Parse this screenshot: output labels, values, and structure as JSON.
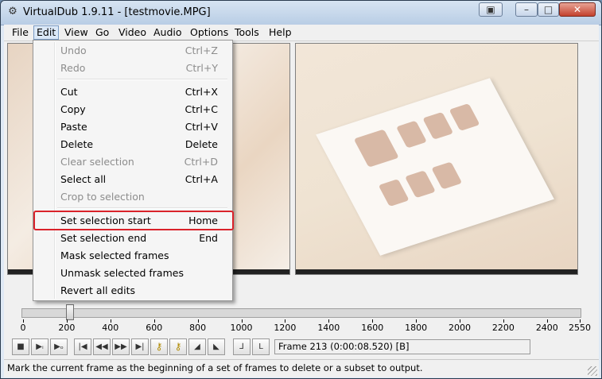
{
  "window": {
    "title": "VirtualDub 1.9.11 - [testmovie.MPG]"
  },
  "title_buttons": {
    "restore": "▣",
    "minimize": "–",
    "maximize": "□",
    "close": "✕"
  },
  "menubar": [
    "File",
    "Edit",
    "View",
    "Go",
    "Video",
    "Audio",
    "Options",
    "Tools",
    "Help"
  ],
  "edit_menu": [
    {
      "label": "Undo",
      "shortcut": "Ctrl+Z",
      "disabled": true
    },
    {
      "label": "Redo",
      "shortcut": "Ctrl+Y",
      "disabled": true
    },
    {
      "label": "Cut",
      "shortcut": "Ctrl+X",
      "disabled": false
    },
    {
      "label": "Copy",
      "shortcut": "Ctrl+C",
      "disabled": false
    },
    {
      "label": "Paste",
      "shortcut": "Ctrl+V",
      "disabled": false
    },
    {
      "label": "Delete",
      "shortcut": "Delete",
      "disabled": false
    },
    {
      "label": "Clear selection",
      "shortcut": "Ctrl+D",
      "disabled": true
    },
    {
      "label": "Select all",
      "shortcut": "Ctrl+A",
      "disabled": false
    },
    {
      "label": "Crop to selection",
      "shortcut": "",
      "disabled": true
    },
    {
      "label": "Set selection start",
      "shortcut": "Home",
      "disabled": false,
      "highlighted": true
    },
    {
      "label": "Set selection end",
      "shortcut": "End",
      "disabled": false
    },
    {
      "label": "Mask selected frames",
      "shortcut": "",
      "disabled": false
    },
    {
      "label": "Unmask selected frames",
      "shortcut": "",
      "disabled": false
    },
    {
      "label": "Revert all edits",
      "shortcut": "",
      "disabled": false
    }
  ],
  "timeline": {
    "ticks": [
      "0",
      "200",
      "400",
      "600",
      "800",
      "1000",
      "1200",
      "1400",
      "1600",
      "1800",
      "2000",
      "2200",
      "2400",
      "2550"
    ],
    "current_frame": 213,
    "total_frames": 2550
  },
  "toolbar": {
    "buttons": [
      {
        "name": "stop-button",
        "glyph": "■"
      },
      {
        "name": "play-input-button",
        "glyph": "▶ᵢ"
      },
      {
        "name": "play-output-button",
        "glyph": "▶ₒ"
      },
      {
        "name": "go-start-button",
        "glyph": "|◀"
      },
      {
        "name": "prev-frame-back-button",
        "glyph": "◀◀"
      },
      {
        "name": "next-frame-forward-button",
        "glyph": "▶▶"
      },
      {
        "name": "go-end-button",
        "glyph": "▶|"
      },
      {
        "name": "prev-key-button",
        "glyph": "⚷"
      },
      {
        "name": "next-key-button",
        "glyph": "⚷"
      },
      {
        "name": "prev-scene-button",
        "glyph": "◢"
      },
      {
        "name": "next-scene-button",
        "glyph": "◣"
      },
      {
        "name": "mark-in-button",
        "glyph": "⅃"
      },
      {
        "name": "mark-out-button",
        "glyph": "L"
      }
    ],
    "frame_info": "Frame 213 (0:00:08.520) [B]"
  },
  "status": "Mark the current frame as the beginning of a set of frames to delete or a subset to output."
}
